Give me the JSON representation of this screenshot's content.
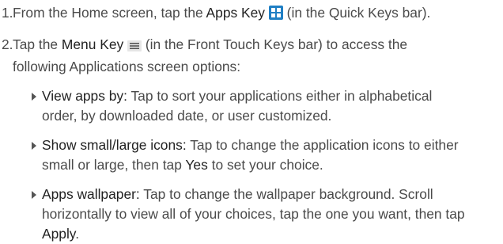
{
  "steps": [
    {
      "number": "1.",
      "text_before": "From the Home screen, tap the ",
      "key_label": "Apps Key",
      "key_icon": "apps-grid-icon",
      "text_after": " (in the Quick Keys bar)."
    },
    {
      "number": "2.",
      "text_before": "Tap the ",
      "key_label": "Menu Key",
      "key_icon": "menu-lines-icon",
      "text_after_line1": " (in the Front Touch Keys bar) to access the",
      "text_after_line2": "following Applications screen options:"
    }
  ],
  "options": [
    {
      "title": "View apps by:",
      "line1": " Tap to sort your applications either in alphabetical",
      "line2": "order, by downloaded date, or user customized."
    },
    {
      "title": "Show small/large icons:",
      "line1": " Tap to change the application icons to either",
      "line2_before": "small or large, then tap ",
      "line2_bold": "Yes",
      "line2_after": " to set your choice."
    },
    {
      "title": "Apps wallpaper:",
      "line1": " Tap to change the wallpaper background. Scroll",
      "line2": "horizontally to view all of your choices, tap the one you want, then tap",
      "line3_bold": "Apply",
      "line3_after": "."
    }
  ],
  "colors": {
    "apps_key_icon": "#1f7fc4",
    "text": "#4a4a4a",
    "emphasis": "#222222"
  }
}
